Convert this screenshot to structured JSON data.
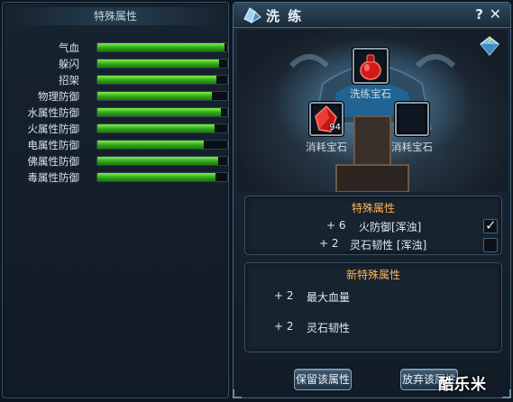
{
  "left_panel": {
    "title": "特殊属性",
    "attributes": [
      {
        "label": "气血",
        "fill": 0.98
      },
      {
        "label": "躲闪",
        "fill": 0.94
      },
      {
        "label": "招架",
        "fill": 0.92
      },
      {
        "label": "物理防御",
        "fill": 0.88
      },
      {
        "label": "水属性防御",
        "fill": 0.95
      },
      {
        "label": "火属性防御",
        "fill": 0.9
      },
      {
        "label": "电属性防御",
        "fill": 0.82
      },
      {
        "label": "佛属性防御",
        "fill": 0.93
      },
      {
        "label": "毒属性防御",
        "fill": 0.91
      }
    ]
  },
  "dialog": {
    "title": "洗 练",
    "help": "?",
    "close": "✕",
    "main_slot_label": "洗练宝石",
    "consume_slots": [
      {
        "label": "消耗宝石",
        "count": "94"
      },
      {
        "label": "消耗宝石",
        "count": ""
      }
    ],
    "special": {
      "title": "特殊属性",
      "rows": [
        {
          "value": "+ 6",
          "name": "火防御[浑浊]",
          "checked": true
        },
        {
          "value": "+ 2",
          "name": "灵石韧性 [浑浊]",
          "checked": false
        }
      ]
    },
    "new_special": {
      "title": "新特殊属性",
      "rows": [
        {
          "value": "+ 2",
          "name": "最大血量"
        },
        {
          "value": "+ 2",
          "name": "灵石韧性"
        }
      ]
    },
    "buttons": {
      "keep": "保留该属性",
      "discard": "放弃该属性"
    }
  },
  "watermark": "酷乐米",
  "colors": {
    "bar_green": "#2fa617",
    "box_title": "#ffb45a",
    "gem_red": "#d11a1a"
  }
}
